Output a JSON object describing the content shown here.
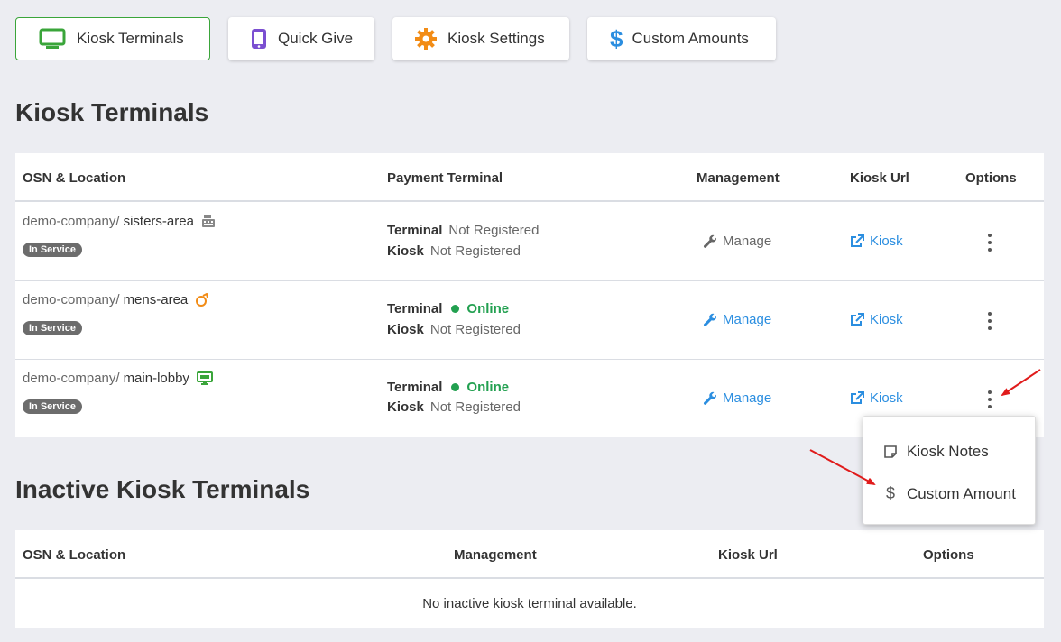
{
  "tabs": [
    {
      "label": "Kiosk Terminals",
      "icon": "monitor-icon",
      "active": true
    },
    {
      "label": "Quick Give",
      "icon": "tablet-icon",
      "active": false
    },
    {
      "label": "Kiosk Settings",
      "icon": "gear-icon",
      "active": false
    },
    {
      "label": "Custom Amounts",
      "icon": "dollar-icon",
      "active": false
    }
  ],
  "active_section": {
    "title": "Kiosk Terminals",
    "headers": {
      "location": "OSN & Location",
      "payment": "Payment Terminal",
      "management": "Management",
      "kiosk_url": "Kiosk Url",
      "options": "Options"
    },
    "rows": [
      {
        "company": "demo-company/",
        "name": "sisters-area",
        "device_icon": "register-icon",
        "badge": "In Service",
        "terminal_label": "Terminal",
        "terminal_status": "Not Registered",
        "kiosk_label": "Kiosk",
        "kiosk_status": "Not Registered",
        "manage_label": "Manage",
        "kiosk_link": "Kiosk"
      },
      {
        "company": "demo-company/",
        "name": "mens-area",
        "device_icon": "swipe-icon",
        "badge": "In Service",
        "terminal_label": "Terminal",
        "terminal_status": "Online",
        "kiosk_label": "Kiosk",
        "kiosk_status": "Not Registered",
        "manage_label": "Manage",
        "kiosk_link": "Kiosk"
      },
      {
        "company": "demo-company/",
        "name": "main-lobby",
        "device_icon": "desktop-icon",
        "badge": "In Service",
        "terminal_label": "Terminal",
        "terminal_status": "Online",
        "kiosk_label": "Kiosk",
        "kiosk_status": "Not Registered",
        "manage_label": "Manage",
        "kiosk_link": "Kiosk"
      }
    ]
  },
  "inactive_section": {
    "title": "Inactive Kiosk Terminals",
    "headers": {
      "location": "OSN & Location",
      "management": "Management",
      "kiosk_url": "Kiosk Url",
      "options": "Options"
    },
    "empty_message": "No inactive kiosk terminal available."
  },
  "options_menu": {
    "items": [
      {
        "label": "Kiosk Notes",
        "icon": "note-icon"
      },
      {
        "label": "Custom Amount",
        "icon": "dollar-icon"
      }
    ]
  },
  "colors": {
    "accent_green": "#3aa53a",
    "link_blue": "#2b8ee0",
    "online_green": "#22a050",
    "annotation_red": "#e01b1b",
    "badge_gray": "#6c6c6c"
  }
}
